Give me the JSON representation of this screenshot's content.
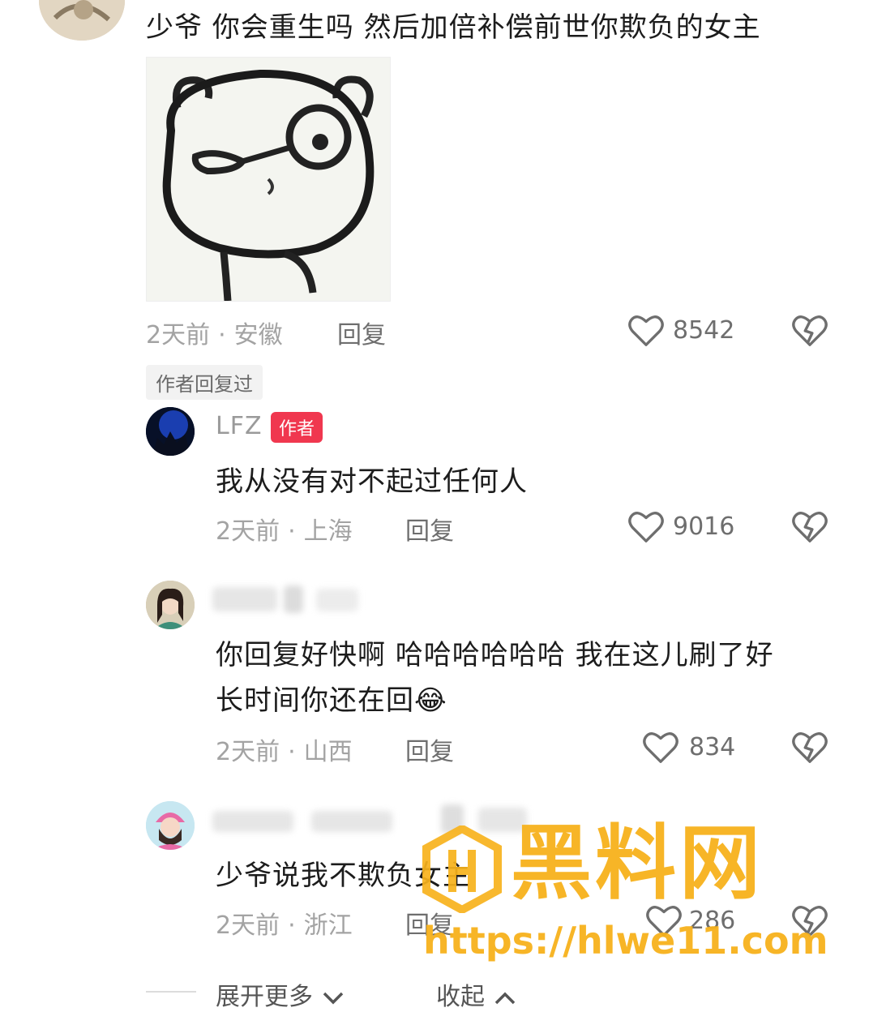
{
  "comment": {
    "text": "少爷 你会重生吗 然后加倍补偿前世你欺负的女主",
    "time": "2天前",
    "location": "安徽",
    "reply_label": "回复",
    "likes": "8542",
    "author_replied_tag": "作者回复过"
  },
  "replies": [
    {
      "username": "LFZ",
      "badge": "作者",
      "text": "我从没有对不起过任何人",
      "time": "2天前",
      "location": "上海",
      "reply_label": "回复",
      "likes": "9016"
    },
    {
      "text_line1": "你回复好快啊 哈哈哈哈哈哈 我在这儿刷了好",
      "text_line2": "长时间你还在回",
      "emoji": "😂",
      "time": "2天前",
      "location": "山西",
      "reply_label": "回复",
      "likes": "834"
    },
    {
      "text": "少爷说我不欺负女主",
      "time": "2天前",
      "location": "浙江",
      "reply_label": "回复",
      "likes": "286"
    }
  ],
  "footer": {
    "expand_label": "展开更多",
    "collapse_label": "收起"
  },
  "watermark": {
    "brand": "黑料网",
    "url": "https://hlwe11.com"
  },
  "colors": {
    "accent_badge": "#f0374f",
    "watermark": "#f7b21c",
    "meta": "#a3a3a3"
  }
}
